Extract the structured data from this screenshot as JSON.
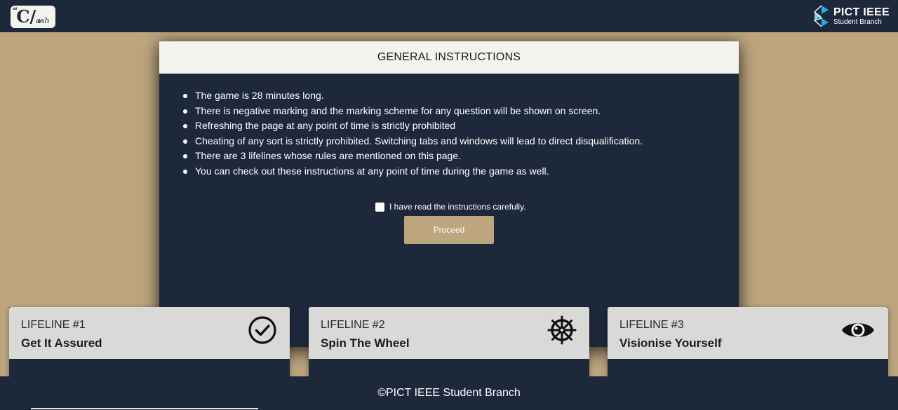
{
  "header": {
    "logo_text": "C/ash",
    "logo_main": "C/",
    "logo_sub": "ash",
    "branch_title": "PICT IEEE",
    "branch_subtitle": "Student Branch"
  },
  "modal": {
    "title": "GENERAL INSTRUCTIONS",
    "rules": [
      "The game is 28 minutes long.",
      "There is negative marking and the marking scheme for any question will be shown on screen.",
      "Refreshing the page at any point of time is strictly prohibited",
      "Cheating of any sort is strictly prohibited. Switching tabs and windows will lead to direct disqualification.",
      "There are 3 lifelines whose rules are mentioned on this page.",
      "You can check out these instructions at any point of time during the game as well."
    ],
    "agree_label": "I have read the instructions carefully.",
    "agree_checked": false,
    "proceed_label": "Proceed"
  },
  "lifelines": [
    {
      "number": "LIFELINE #1",
      "title": "Get It Assured",
      "icon": "check-circle-icon"
    },
    {
      "number": "LIFELINE #2",
      "title": "Spin The Wheel",
      "icon": "wheel-icon"
    },
    {
      "number": "LIFELINE #3",
      "title": "Visionise Yourself",
      "icon": "eye-icon"
    }
  ],
  "footer": {
    "text": "©PICT IEEE Student Branch"
  },
  "colors": {
    "navy": "#1e283b",
    "tan": "#bda57f",
    "cream": "#f4f3ee"
  }
}
